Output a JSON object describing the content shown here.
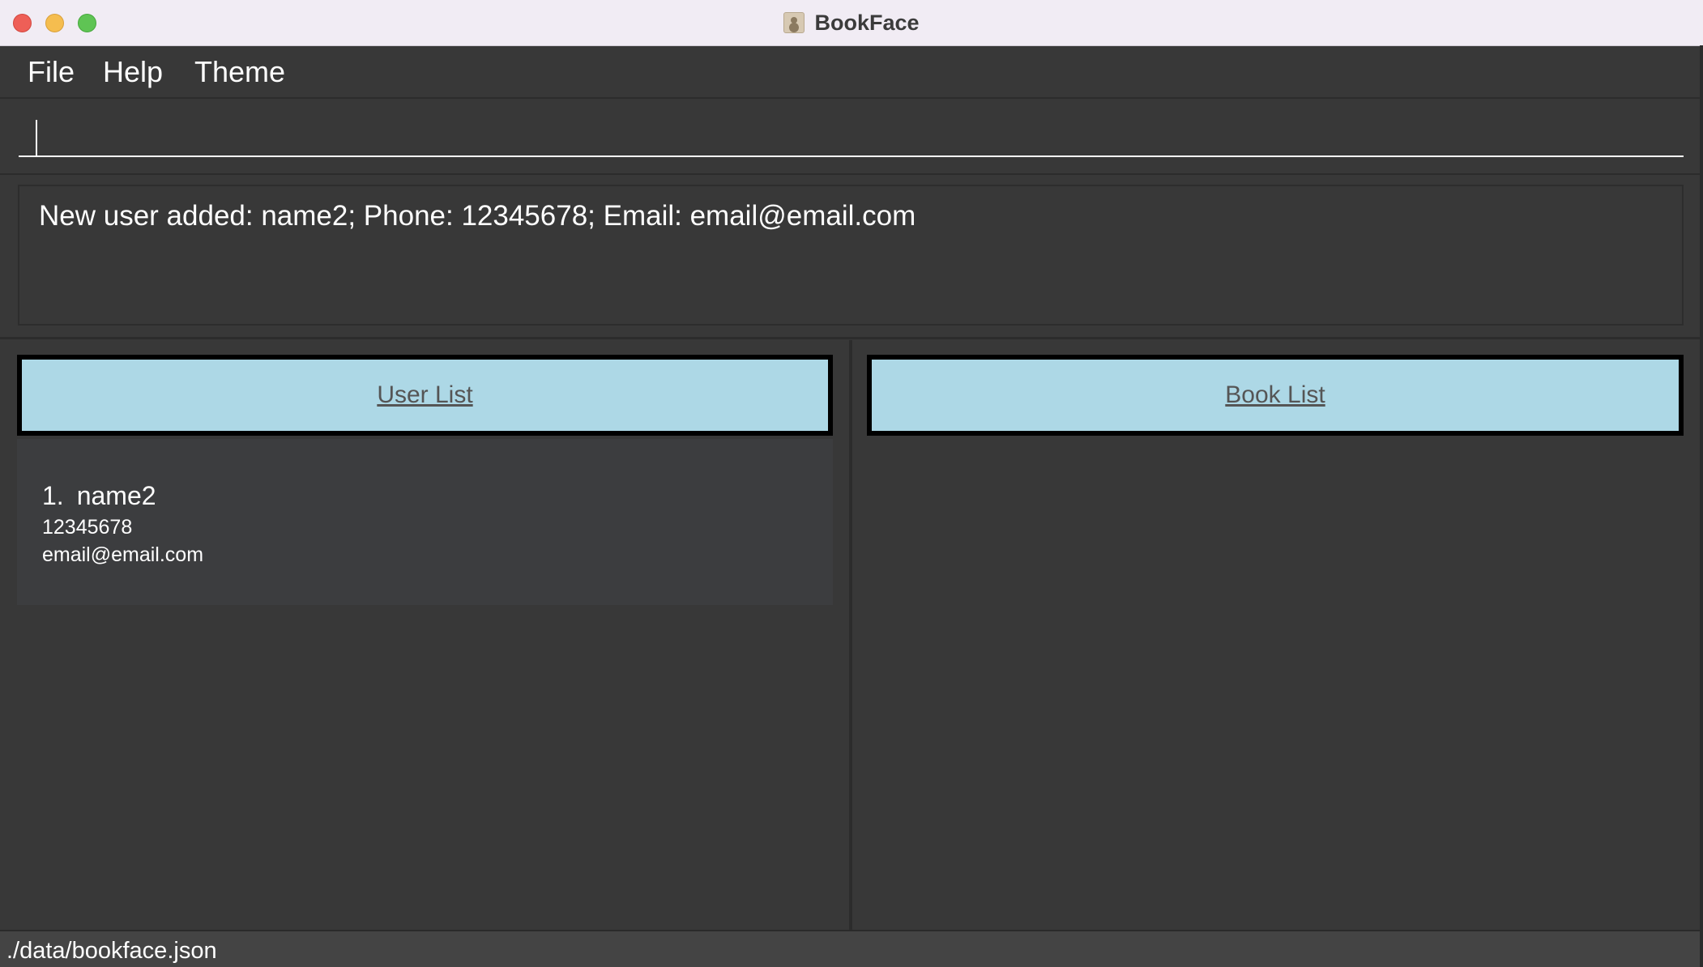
{
  "window": {
    "title": "BookFace",
    "app_icon": "contact-card-icon"
  },
  "menu": {
    "items": [
      "File",
      "Help",
      "Theme"
    ]
  },
  "command": {
    "value": "",
    "placeholder": ""
  },
  "result": {
    "message": "New user added: name2; Phone: 12345678; Email: email@email.com"
  },
  "user_panel": {
    "header": "User List",
    "users": [
      {
        "index": "1.",
        "name": "name2",
        "phone": "12345678",
        "email": "email@email.com"
      }
    ]
  },
  "book_panel": {
    "header": "Book List",
    "books": []
  },
  "status": {
    "path": "./data/bookface.json"
  },
  "colors": {
    "background": "#383838",
    "panel_header": "#add8e6",
    "panel_header_border": "#000000",
    "list_cell": "#3c3d3f",
    "text": "#ffffff"
  }
}
